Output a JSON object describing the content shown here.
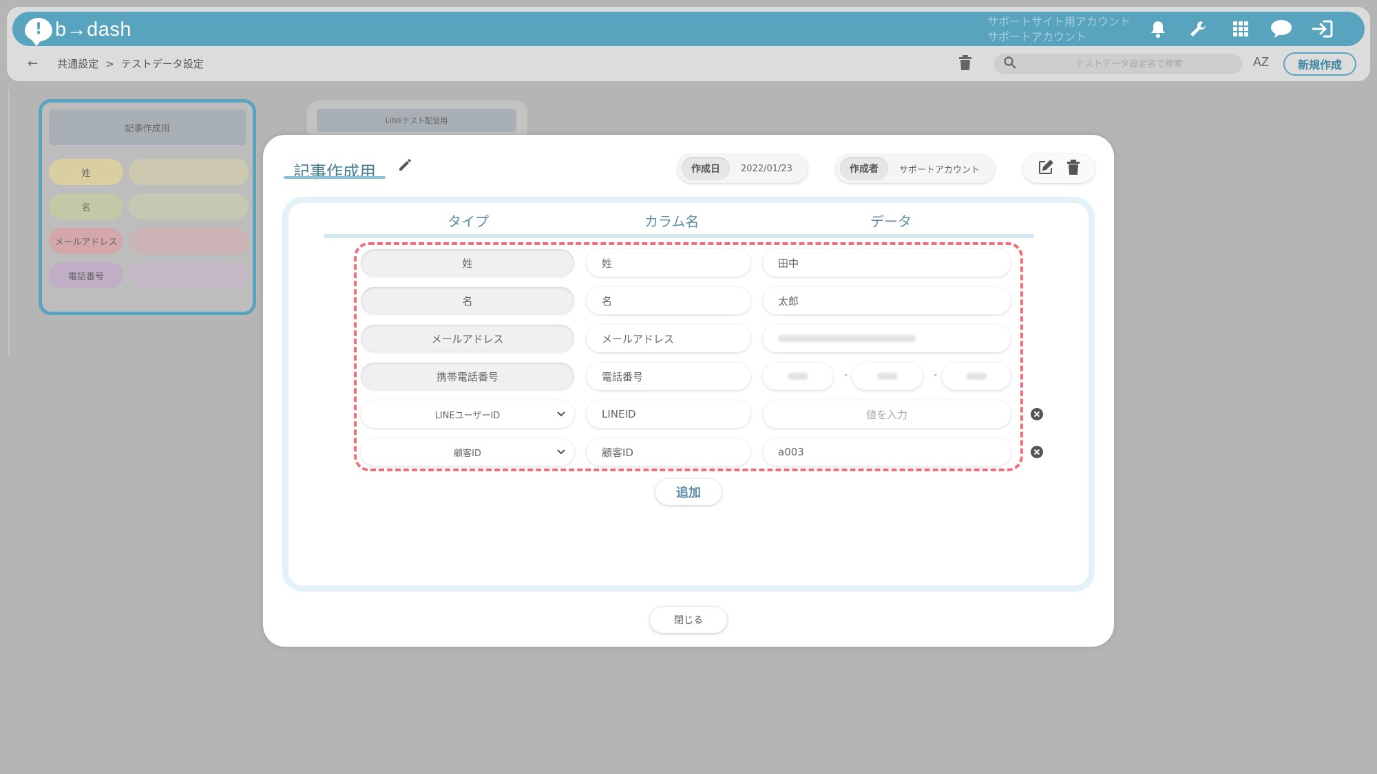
{
  "app": {
    "logo_mark": "!",
    "logo_text": "b→dash"
  },
  "header": {
    "account_site": "サポートサイト用アカウント",
    "account_user": "サポートアカウント",
    "icons": [
      "bell-icon",
      "wrench-icon",
      "grid-icon",
      "chat-icon",
      "logout-icon"
    ]
  },
  "breadcrumb": {
    "parent": "共通設定",
    "separator": ">",
    "current": "テストデータ設定"
  },
  "toolbar": {
    "search_placeholder": "テストデータ設定名で検索",
    "sort_label": "AZ",
    "new_button": "新規作成"
  },
  "background_cards": [
    {
      "title": "記事作成用",
      "rows": [
        {
          "type": "姓",
          "color": "#d9cfa0"
        },
        {
          "type": "名",
          "color": "#c3c9a7"
        },
        {
          "type": "メールアドレス",
          "color": "#d4a7ab"
        },
        {
          "type": "電話番号",
          "color": "#c1adc6"
        }
      ]
    },
    {
      "title": "LINEテスト配信用"
    }
  ],
  "modal": {
    "title": "記事作成用",
    "created_date_label": "作成日",
    "created_date": "2022/01/23",
    "author_label": "作成者",
    "author": "サポートアカウント",
    "columns": {
      "type": "タイプ",
      "column_name": "カラム名",
      "data": "データ"
    },
    "rows": [
      {
        "type": "姓",
        "column": "姓",
        "data": "田中"
      },
      {
        "type": "名",
        "column": "名",
        "data": "太郎"
      },
      {
        "type": "メールアドレス",
        "column": "メールアドレス",
        "data": ""
      },
      {
        "type": "携帯電話番号",
        "column": "電話番号",
        "data": "",
        "phone_sep": "-"
      },
      {
        "type": "LINEユーザーID",
        "column": "LINEID",
        "data_placeholder": "値を入力"
      },
      {
        "type": "顧客ID",
        "column": "顧客ID",
        "data": "a003"
      }
    ],
    "add_button": "追加",
    "close_button": "閉じる"
  },
  "colors": {
    "accent": "#58a3bd",
    "highlight_dash": "#ef6f7f",
    "overlay": "#b5b5b5"
  }
}
